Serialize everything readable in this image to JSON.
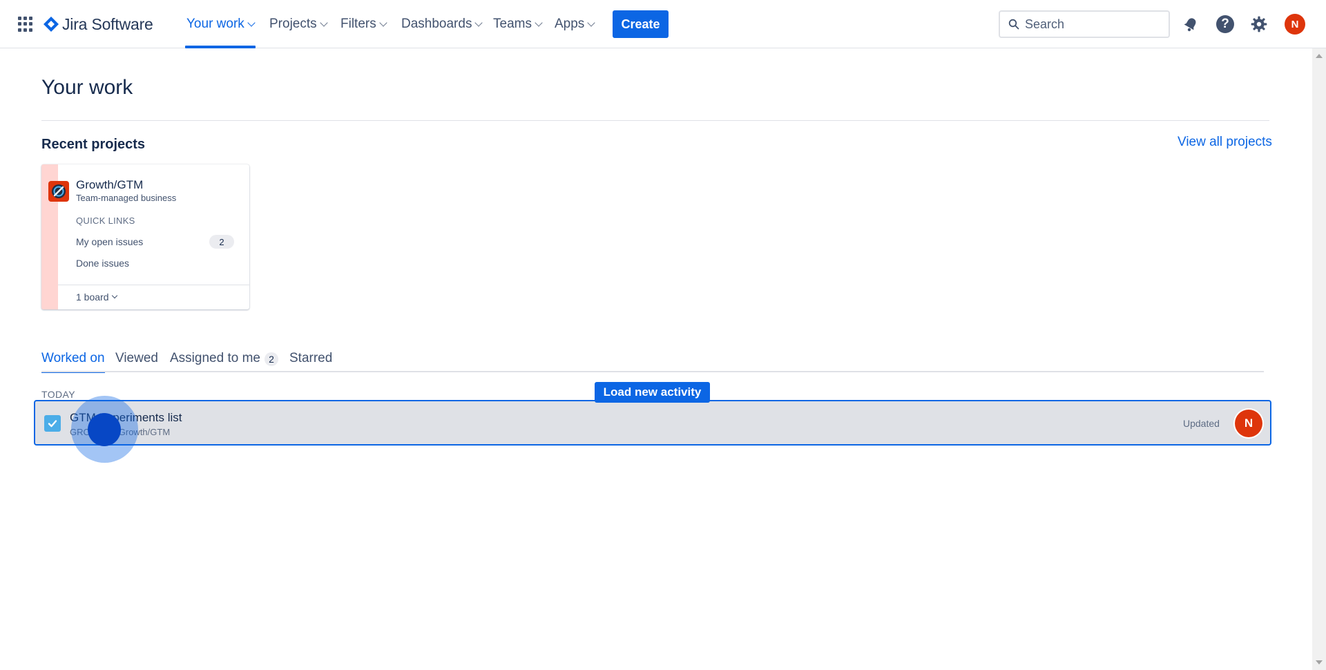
{
  "app": {
    "name": "Jira Software",
    "user_initial": "N",
    "accent_color": "#0c66e4",
    "avatar_color": "#de350b"
  },
  "nav": {
    "items": [
      {
        "label": "Your work",
        "active": true
      },
      {
        "label": "Projects"
      },
      {
        "label": "Filters"
      },
      {
        "label": "Dashboards"
      },
      {
        "label": "Teams"
      },
      {
        "label": "Apps"
      }
    ],
    "create_label": "Create",
    "search_placeholder": "Search",
    "icons": [
      "app-switcher-icon",
      "notifications-icon",
      "help-icon",
      "settings-icon"
    ]
  },
  "page": {
    "title": "Your work",
    "recent_projects_title": "Recent projects",
    "view_all_label": "View all projects"
  },
  "project_card": {
    "name": "Growth/GTM",
    "type": "Team-managed business",
    "quick_links_title": "QUICK LINKS",
    "links": [
      {
        "label": "My open issues",
        "count": "2"
      },
      {
        "label": "Done issues"
      }
    ],
    "board_label": "1 board",
    "stripe_color": "#ffd5d2"
  },
  "tabs": [
    {
      "label": "Worked on",
      "active": true
    },
    {
      "label": "Viewed"
    },
    {
      "label": "Assigned to me",
      "count": "2"
    },
    {
      "label": "Starred"
    }
  ],
  "activity": {
    "group_label": "TODAY",
    "load_new_label": "Load new activity",
    "items": [
      {
        "title": "GTM Experiments list",
        "subtitle": "GROWTH · Growth/GTM",
        "status": "Updated",
        "avatar_initial": "N",
        "icon": "task-checkbox-icon"
      }
    ]
  }
}
